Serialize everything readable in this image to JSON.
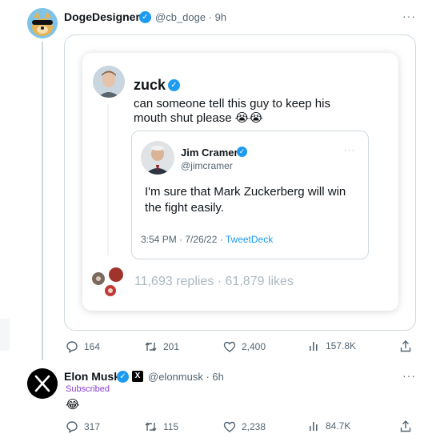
{
  "post": {
    "author": "DogeDesigner",
    "handle": "@cb_doge",
    "time": "9h",
    "more": "···",
    "metrics": {
      "replies": "164",
      "reposts": "201",
      "likes": "2,400",
      "views": "157.8K"
    }
  },
  "embed": {
    "author": "zuck",
    "text_line1": "can someone tell this guy to keep his",
    "text_line2": "mouth shut please 😭😭",
    "footer": "11,693 replies · 61,879 likes",
    "quote": {
      "author": "Jim Cramer",
      "handle": "@jimcramer",
      "more": "···",
      "line1": "I'm sure that Mark Zuckerberg will win",
      "line2": "the fight easily.",
      "timestamp": "3:54 PM · 7/26/22 ·",
      "source": "TweetDeck"
    }
  },
  "reply": {
    "author": "Elon Musk",
    "handle": "@elonmusk",
    "time": "6h",
    "badge": "Subscribed",
    "emoji": "😂",
    "more": "···",
    "metrics": {
      "replies": "317",
      "reposts": "115",
      "likes": "2,238",
      "views": "84.7K"
    }
  },
  "colors": {
    "accent": "#1d9bf0",
    "muted": "#536471",
    "subscribed": "#8b3fd4"
  }
}
